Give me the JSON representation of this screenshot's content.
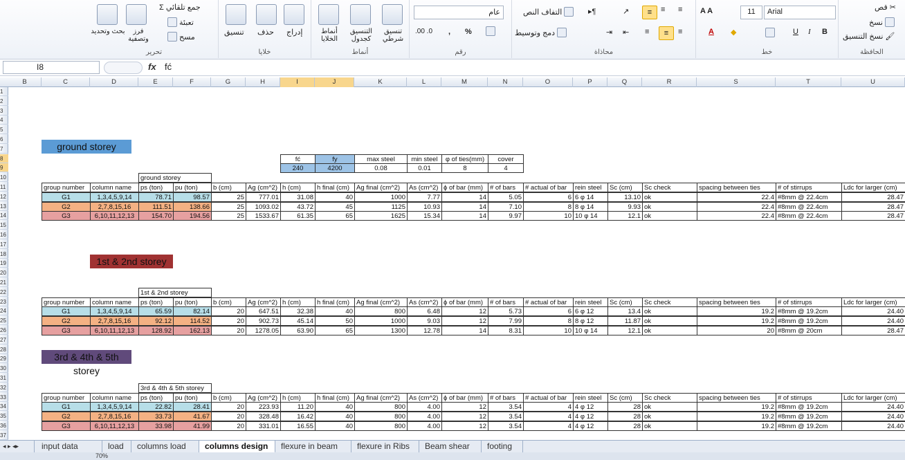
{
  "ribbon": {
    "clipboard": {
      "label": "الحافظة",
      "cut": "قص",
      "copy": "نسخ",
      "format_painter": "نسخ التنسيق"
    },
    "font": {
      "label": "خط",
      "name": "Arial",
      "size": "11",
      "bold": "B",
      "italic": "I",
      "underline": "U"
    },
    "alignment": {
      "label": "محاذاة",
      "wrap": "التفاف النص",
      "merge": "دمج وتوسيط"
    },
    "number": {
      "label": "رقم",
      "format": "عام",
      "percent": "%",
      "comma": ","
    },
    "styles": {
      "label": "أنماط",
      "conditional": "تنسيق شرطي",
      "as_table": "التنسيق كجدول",
      "cell_styles": "أنماط الخلايا"
    },
    "cells": {
      "label": "خلايا",
      "insert": "إدراج",
      "delete": "حذف",
      "format": "تنسيق"
    },
    "editing": {
      "label": "تحرير",
      "autosum": "جمع تلقائي",
      "fill": "تعبئة",
      "clear": "مسح",
      "sort": "فرز وتصفية",
      "find": "بحث وتحديد"
    }
  },
  "formula_bar": {
    "name_box": "I8",
    "fx": "fx",
    "content": "fć"
  },
  "columns": [
    "B",
    "C",
    "D",
    "E",
    "F",
    "G",
    "H",
    "I",
    "J",
    "K",
    "L",
    "M",
    "N",
    "O",
    "P",
    "Q",
    "R",
    "S",
    "T",
    "U"
  ],
  "rows": [
    "1",
    "2",
    "3",
    "4",
    "5",
    "6",
    "7",
    "8",
    "9",
    "10",
    "11",
    "12",
    "13",
    "14",
    "15",
    "16",
    "17",
    "18",
    "19",
    "20",
    "21",
    "22",
    "23",
    "24",
    "25",
    "26",
    "27",
    "28",
    "29",
    "30",
    "31",
    "32",
    "33",
    "34",
    "35",
    "36",
    "37",
    "38"
  ],
  "params": {
    "headers": [
      "fć",
      "fy",
      "max steel",
      "min steel",
      "φ of ties(mm)",
      "cover"
    ],
    "values": [
      "240",
      "4200",
      "0.08",
      "0.01",
      "8",
      "4"
    ]
  },
  "table_headers": [
    "group number",
    "column name",
    "ps (ton)",
    "pu (ton)",
    "b (cm)",
    "Ag (cm^2)",
    "h (cm)",
    "h final (cm)",
    "Ag final (cm^2)",
    "As (cm^2)",
    "ϕ of bar (mm)",
    "# of bars",
    "# actual of bar",
    "rein steel",
    "Sc (cm)",
    "Sc check",
    "spacing between ties",
    "# of stirrups",
    "Ldc for larger (cm)"
  ],
  "sections": [
    {
      "title": "ground storey",
      "subtitle": "ground storey",
      "color": "#5b9bd5",
      "rows": [
        [
          "G1",
          "1,3,4,5,9,14",
          "78.71",
          "98.57",
          "25",
          "777.01",
          "31.08",
          "40",
          "1000",
          "7.77",
          "14",
          "5.05",
          "6",
          "6 φ 14",
          "13.10",
          "ok",
          "22.4",
          "#8mm @ 22.4cm",
          "28.47"
        ],
        [
          "G2",
          "2,7,8,15,16",
          "111.51",
          "138.66",
          "25",
          "1093.02",
          "43.72",
          "45",
          "1125",
          "10.93",
          "14",
          "7.10",
          "8",
          "8 φ 14",
          "9.93",
          "ok",
          "22.4",
          "#8mm @ 22.4cm",
          "28.47"
        ],
        [
          "G3",
          "6,10,11,12,13",
          "154.70",
          "194.56",
          "25",
          "1533.67",
          "61.35",
          "65",
          "1625",
          "15.34",
          "14",
          "9.97",
          "10",
          "10 φ 14",
          "12.1",
          "ok",
          "22.4",
          "#8mm @ 22.4cm",
          "28.47"
        ]
      ]
    },
    {
      "title": "1st & 2nd storey",
      "subtitle": "1st & 2nd storey",
      "color": "#a03232",
      "rows": [
        [
          "G1",
          "1,3,4,5,9,14",
          "65.59",
          "82.14",
          "20",
          "647.51",
          "32.38",
          "40",
          "800",
          "6.48",
          "12",
          "5.73",
          "6",
          "6 φ 12",
          "13.4",
          "ok",
          "19.2",
          "#8mm @ 19.2cm",
          "24.40"
        ],
        [
          "G2",
          "2,7,8,15,16",
          "92.12",
          "114.52",
          "20",
          "902.73",
          "45.14",
          "50",
          "1000",
          "9.03",
          "12",
          "7.99",
          "8",
          "8 φ 12",
          "11.87",
          "ok",
          "19.2",
          "#8mm @ 19.2cm",
          "24.40"
        ],
        [
          "G3",
          "6,10,11,12,13",
          "128.92",
          "162.13",
          "20",
          "1278.05",
          "63.90",
          "65",
          "1300",
          "12.78",
          "14",
          "8.31",
          "10",
          "10 φ 14",
          "12.1",
          "ok",
          "20",
          "#8mm @ 20cm",
          "28.47"
        ]
      ]
    },
    {
      "title": "3rd & 4th & 5th storey",
      "subtitle": "3rd & 4th & 5th storey",
      "color": "#604a7b",
      "rows": [
        [
          "G1",
          "1,3,4,5,9,14",
          "22.82",
          "28.41",
          "20",
          "223.93",
          "11.20",
          "40",
          "800",
          "4.00",
          "12",
          "3.54",
          "4",
          "4 φ 12",
          "28",
          "ok",
          "19.2",
          "#8mm @ 19.2cm",
          "24.40"
        ],
        [
          "G2",
          "2,7,8,15,16",
          "33.73",
          "41.67",
          "20",
          "328.48",
          "16.42",
          "40",
          "800",
          "4.00",
          "12",
          "3.54",
          "4",
          "4 φ 12",
          "28",
          "ok",
          "19.2",
          "#8mm @ 19.2cm",
          "24.40"
        ],
        [
          "G3",
          "6,10,11,12,13",
          "33.98",
          "41.99",
          "20",
          "331.01",
          "16.55",
          "40",
          "800",
          "4.00",
          "12",
          "3.54",
          "4",
          "4 φ 12",
          "28",
          "ok",
          "19.2",
          "#8mm @ 19.2cm",
          "24.40"
        ]
      ]
    }
  ],
  "group_colors": [
    "#b7dee8",
    "#f4b183",
    "#e6a0a0"
  ],
  "sheet_tabs": [
    "input data",
    "load",
    "columns load",
    "columns design",
    "flexure in beam",
    "flexure in Ribs",
    "Beam shear",
    "footing"
  ],
  "active_tab": "columns design",
  "status": {
    "zoom": "70%"
  }
}
